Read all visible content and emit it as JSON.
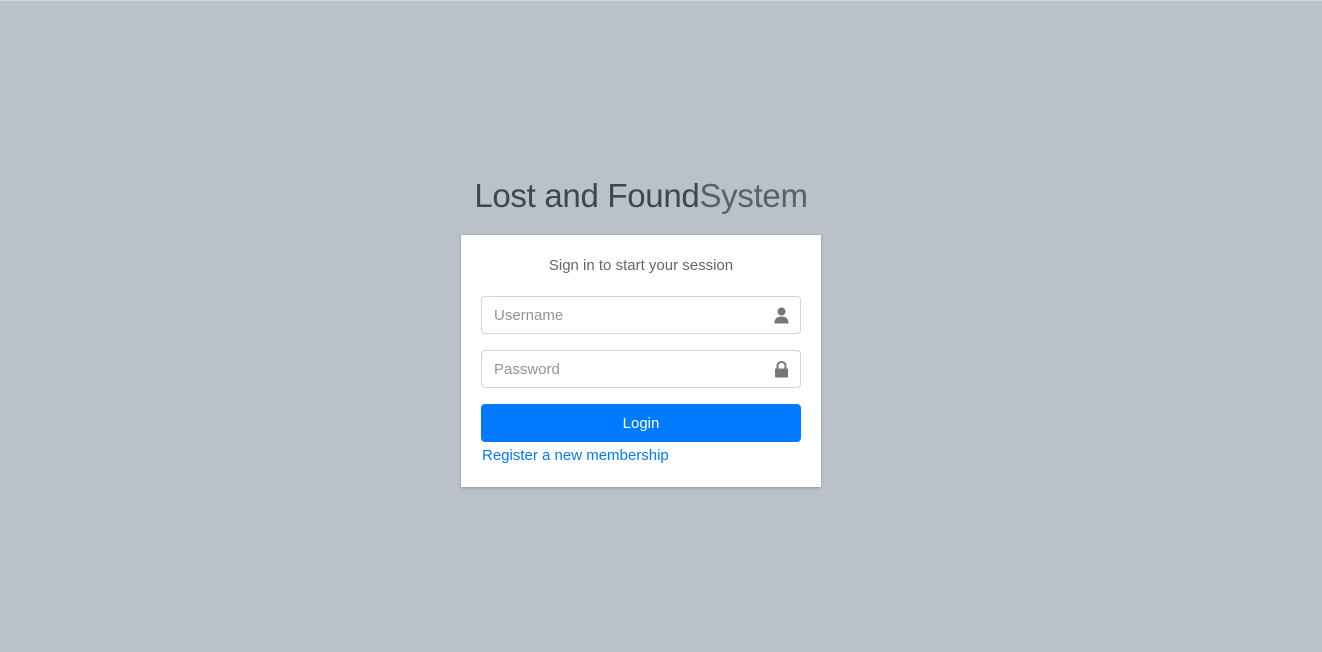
{
  "logo": {
    "strong": "Lost and Found",
    "light": "System"
  },
  "form": {
    "message": "Sign in to start your session",
    "username_placeholder": "Username",
    "password_placeholder": "Password",
    "login_label": "Login",
    "register_label": "Register a new membership",
    "username_icon": "user-icon",
    "password_icon": "lock-icon"
  },
  "colors": {
    "background": "#bac1c8",
    "primary": "#007bff",
    "card": "#ffffff"
  }
}
